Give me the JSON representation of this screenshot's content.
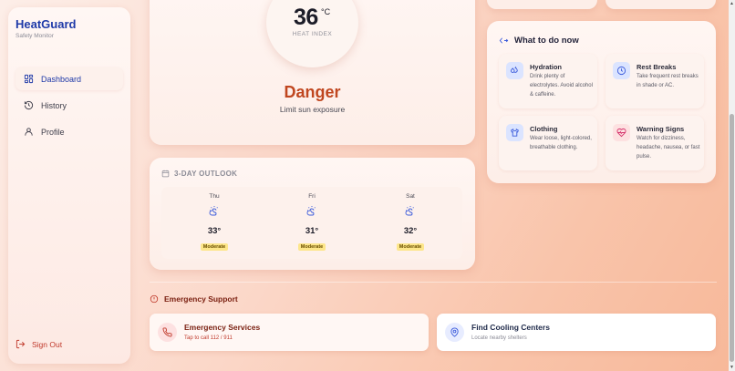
{
  "app": {
    "name": "HeatGuard",
    "subtitle": "Safety Monitor"
  },
  "nav": [
    {
      "label": "Dashboard",
      "icon": "dashboard-icon",
      "active": true
    },
    {
      "label": "History",
      "icon": "history-icon"
    },
    {
      "label": "Profile",
      "icon": "user-icon"
    }
  ],
  "sign_out": "Sign Out",
  "heat": {
    "value": "36",
    "unit": "°C",
    "label": "HEAT INDEX",
    "level": "Danger",
    "advice": "Limit sun exposure"
  },
  "outlook": {
    "title": "3-DAY OUTLOOK",
    "days": [
      {
        "name": "Thu",
        "temp": "33°",
        "badge": "Moderate",
        "icon": "partly-sunny-icon"
      },
      {
        "name": "Fri",
        "temp": "31°",
        "badge": "Moderate",
        "icon": "partly-sunny-icon"
      },
      {
        "name": "Sat",
        "temp": "32°",
        "badge": "Moderate",
        "icon": "partly-sunny-icon"
      }
    ]
  },
  "todo": {
    "title": "What to do now",
    "tips": [
      {
        "title": "Hydration",
        "body": "Drink plenty of electrolytes. Avoid alcohol & caffeine.",
        "icon": "droplets-icon"
      },
      {
        "title": "Rest Breaks",
        "body": "Take frequent rest breaks in shade or AC.",
        "icon": "clock-icon"
      },
      {
        "title": "Clothing",
        "body": "Wear loose, light-colored, breathable clothing.",
        "icon": "shirt-icon"
      },
      {
        "title": "Warning Signs",
        "body": "Watch for dizziness, headache, nausea, or fast pulse.",
        "icon": "heart-pulse-icon"
      }
    ]
  },
  "emergency": {
    "title": "Emergency Support",
    "services": {
      "title": "Emergency Services",
      "subtitle": "Tap to call 112 / 911"
    },
    "cooling": {
      "title": "Find Cooling Centers",
      "subtitle": "Locate nearby shelters"
    }
  },
  "colors": {
    "brand": "#1f3aa8",
    "danger": "#c0461f",
    "badge": "#fde68a"
  }
}
